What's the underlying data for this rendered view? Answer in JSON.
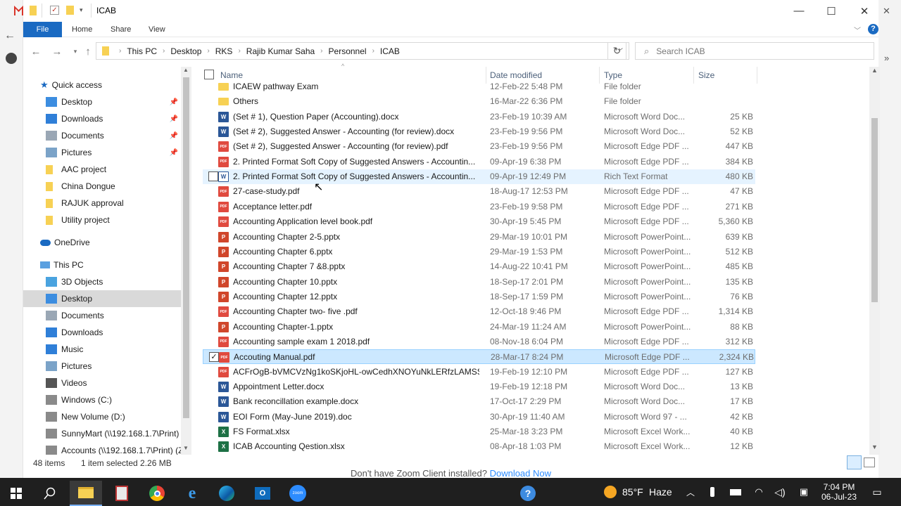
{
  "window": {
    "title": "ICAB",
    "minimize": "—",
    "maximize": "☐",
    "close": "✕"
  },
  "ribbon": {
    "tabs": [
      "File",
      "Home",
      "Share",
      "View"
    ],
    "expand_icon": "chevron-down-icon",
    "help_label": "?"
  },
  "address": {
    "breadcrumbs": [
      "This PC",
      "Desktop",
      "RKS",
      "Rajib Kumar Saha",
      "Personnel",
      "ICAB"
    ],
    "search_placeholder": "Search ICAB"
  },
  "nav": {
    "quick_access": "Quick access",
    "quick_items": [
      {
        "label": "Desktop",
        "icon": "desktop-icon",
        "pinned": true
      },
      {
        "label": "Downloads",
        "icon": "downloads-icon",
        "pinned": true
      },
      {
        "label": "Documents",
        "icon": "documents-icon",
        "pinned": true
      },
      {
        "label": "Pictures",
        "icon": "pictures-icon",
        "pinned": true
      },
      {
        "label": "AAC project",
        "icon": "folder-icon",
        "pinned": false
      },
      {
        "label": "China Dongue",
        "icon": "folder-icon",
        "pinned": false
      },
      {
        "label": "RAJUK approval",
        "icon": "folder-icon",
        "pinned": false
      },
      {
        "label": "Utility project",
        "icon": "folder-icon",
        "pinned": false
      }
    ],
    "onedrive": "OneDrive",
    "this_pc": "This PC",
    "pc_items": [
      {
        "label": "3D Objects",
        "icon": "3d-objects-icon"
      },
      {
        "label": "Desktop",
        "icon": "desktop-icon",
        "selected": true
      },
      {
        "label": "Documents",
        "icon": "documents-icon"
      },
      {
        "label": "Downloads",
        "icon": "downloads-icon"
      },
      {
        "label": "Music",
        "icon": "music-icon"
      },
      {
        "label": "Pictures",
        "icon": "pictures-icon"
      },
      {
        "label": "Videos",
        "icon": "videos-icon"
      },
      {
        "label": "Windows (C:)",
        "icon": "drive-icon"
      },
      {
        "label": "New Volume (D:)",
        "icon": "drive-icon"
      },
      {
        "label": "SunnyMart (\\\\192.168.1.7\\Print) (",
        "icon": "network-drive-icon"
      },
      {
        "label": "Accounts (\\\\192.168.1.7\\Print) (Z:",
        "icon": "network-drive-icon"
      }
    ]
  },
  "columns": {
    "name": "Name",
    "date": "Date modified",
    "type": "Type",
    "size": "Size"
  },
  "files": [
    {
      "name": "ICAEW pathway Exam",
      "date": "12-Feb-22 5:48 PM",
      "type": "File folder",
      "size": "",
      "kind": "folder"
    },
    {
      "name": "Others",
      "date": "16-Mar-22 6:36 PM",
      "type": "File folder",
      "size": "",
      "kind": "folder"
    },
    {
      "name": "(Set # 1), Question Paper (Accounting).docx",
      "date": "23-Feb-19 10:39 AM",
      "type": "Microsoft Word Doc...",
      "size": "25 KB",
      "kind": "word"
    },
    {
      "name": "(Set # 2), Suggested Answer - Accounting (for review).docx",
      "date": "23-Feb-19 9:56 PM",
      "type": "Microsoft Word Doc...",
      "size": "52 KB",
      "kind": "word"
    },
    {
      "name": "(Set # 2), Suggested Answer - Accounting (for review).pdf",
      "date": "23-Feb-19 9:56 PM",
      "type": "Microsoft Edge PDF ...",
      "size": "447 KB",
      "kind": "pdf"
    },
    {
      "name": "2.  Printed Format Soft Copy of Suggested Answers - Accountin...",
      "date": "09-Apr-19 6:38 PM",
      "type": "Microsoft Edge PDF ...",
      "size": "384 KB",
      "kind": "pdf"
    },
    {
      "name": "2.  Printed Format Soft Copy of Suggested Answers - Accountin...",
      "date": "09-Apr-19 12:49 PM",
      "type": "Rich Text Format",
      "size": "480 KB",
      "kind": "rtf",
      "hover": true
    },
    {
      "name": "27-case-study.pdf",
      "date": "18-Aug-17 12:53 PM",
      "type": "Microsoft Edge PDF ...",
      "size": "47 KB",
      "kind": "pdf"
    },
    {
      "name": "Acceptance letter.pdf",
      "date": "23-Feb-19 9:58 PM",
      "type": "Microsoft Edge PDF ...",
      "size": "271 KB",
      "kind": "pdf"
    },
    {
      "name": "Accounting Application level book.pdf",
      "date": "30-Apr-19 5:45 PM",
      "type": "Microsoft Edge PDF ...",
      "size": "5,360 KB",
      "kind": "pdf"
    },
    {
      "name": "Accounting Chapter 2-5.pptx",
      "date": "29-Mar-19 10:01 PM",
      "type": "Microsoft PowerPoint...",
      "size": "639 KB",
      "kind": "ppt"
    },
    {
      "name": "Accounting Chapter 6.pptx",
      "date": "29-Mar-19 1:53 PM",
      "type": "Microsoft PowerPoint...",
      "size": "512 KB",
      "kind": "ppt"
    },
    {
      "name": "Accounting Chapter 7 &8.pptx",
      "date": "14-Aug-22 10:41 PM",
      "type": "Microsoft PowerPoint...",
      "size": "485 KB",
      "kind": "ppt"
    },
    {
      "name": "Accounting Chapter 10.pptx",
      "date": "18-Sep-17 2:01 PM",
      "type": "Microsoft PowerPoint...",
      "size": "135 KB",
      "kind": "ppt"
    },
    {
      "name": "Accounting Chapter 12.pptx",
      "date": "18-Sep-17 1:59 PM",
      "type": "Microsoft PowerPoint...",
      "size": "76 KB",
      "kind": "ppt"
    },
    {
      "name": "Accounting Chapter two- five .pdf",
      "date": "12-Oct-18 9:46 PM",
      "type": "Microsoft Edge PDF ...",
      "size": "1,314 KB",
      "kind": "pdf"
    },
    {
      "name": "Accounting Chapter-1.pptx",
      "date": "24-Mar-19 11:24 AM",
      "type": "Microsoft PowerPoint...",
      "size": "88 KB",
      "kind": "ppt"
    },
    {
      "name": "Accounting sample exam 1 2018.pdf",
      "date": "08-Nov-18 6:04 PM",
      "type": "Microsoft Edge PDF ...",
      "size": "312 KB",
      "kind": "pdf"
    },
    {
      "name": "Accouting Manual.pdf",
      "date": "28-Mar-17 8:24 PM",
      "type": "Microsoft Edge PDF ...",
      "size": "2,324 KB",
      "kind": "pdf",
      "selected": true
    },
    {
      "name": "ACFrOgB-bVMCVzNg1koSKjoHL-owCedhXNOYuNkLERfzLAMSS...",
      "date": "19-Feb-19 12:10 PM",
      "type": "Microsoft Edge PDF ...",
      "size": "127 KB",
      "kind": "pdf"
    },
    {
      "name": "Appointment Letter.docx",
      "date": "19-Feb-19 12:18 PM",
      "type": "Microsoft Word Doc...",
      "size": "13 KB",
      "kind": "word"
    },
    {
      "name": "Bank reconcillation example.docx",
      "date": "17-Oct-17 2:29 PM",
      "type": "Microsoft Word Doc...",
      "size": "17 KB",
      "kind": "word"
    },
    {
      "name": "EOI Form (May-June 2019).doc",
      "date": "30-Apr-19 11:40 AM",
      "type": "Microsoft Word 97 - ...",
      "size": "42 KB",
      "kind": "word"
    },
    {
      "name": "FS Format.xlsx",
      "date": "25-Mar-18 3:23 PM",
      "type": "Microsoft Excel Work...",
      "size": "40 KB",
      "kind": "xls"
    },
    {
      "name": "ICAB Accounting Qestion.xlsx",
      "date": "08-Apr-18 1:03 PM",
      "type": "Microsoft Excel Work...",
      "size": "12 KB",
      "kind": "xls"
    }
  ],
  "status": {
    "count": "48 items",
    "selected": "1 item selected  2.26 MB"
  },
  "zoom_banner": {
    "text": "Don't have Zoom Client installed?",
    "link": "Download Now"
  },
  "taskbar": {
    "apps": [
      "start-icon",
      "search-icon",
      "file-explorer-icon",
      "notepad-icon",
      "chrome-icon",
      "ie-icon",
      "edge-icon",
      "outlook-icon",
      "zoom-icon",
      "help-icon"
    ],
    "weather_temp": "85°F",
    "weather_desc": "Haze",
    "time": "7:04 PM",
    "date": "06-Jul-23"
  },
  "colors": {
    "accent": "#1a6ac2",
    "selected_row": "#cce8ff",
    "taskbar": "#1f1f1f"
  }
}
